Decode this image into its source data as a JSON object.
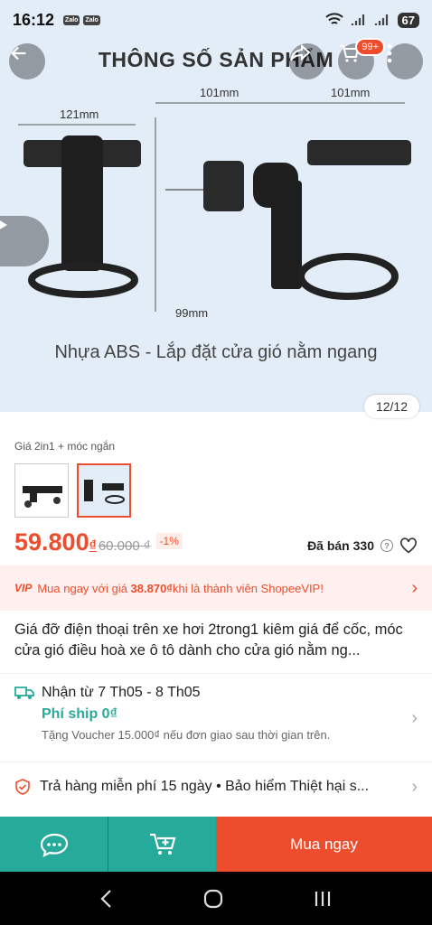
{
  "status": {
    "time": "16:12",
    "app1": "Zalo",
    "app2": "Zalo",
    "battery": "67"
  },
  "hero": {
    "title": "THÔNG SỐ SẢN PHẨM",
    "caption": "Nhựa ABS - Lắp đặt cửa gió nằm ngang",
    "dim_121": "121mm",
    "dim_101a": "101mm",
    "dim_101b": "101mm",
    "dim_99": "99mm",
    "cart_badge": "99+",
    "counter": "12/12"
  },
  "variation": {
    "label": "Giá 2in1 + móc ngắn"
  },
  "price": {
    "current": "59.800",
    "currency": "₫",
    "old": "60.000 ₫",
    "discount": "-1%",
    "sold": "Đã bán 330"
  },
  "vip": {
    "tag": "VIP",
    "text_before": "Mua ngay với giá ",
    "vip_price": "38.870₫",
    "text_after": " khi là thành viên ShopeeVIP!"
  },
  "product": {
    "title": "Giá đỡ điện thoại trên xe hơi 2trong1 kiêm giá để cốc, móc cửa gió điều hoà xe ô tô dành cho cửa gió nằm ng..."
  },
  "shipping": {
    "delivery": "Nhận từ 7 Th05 - 8 Th05",
    "fee": "Phí ship 0₫",
    "note": "Tặng Voucher 15.000₫ nếu đơn giao sau thời gian trên."
  },
  "returns": {
    "text": "Trả hàng miễn phí 15 ngày  •  Bảo hiểm Thiệt hại s..."
  },
  "footer": {
    "buy_now": "Mua ngay"
  },
  "colors": {
    "primary": "#ee4d2d",
    "teal": "#26aa99",
    "hero_bg": "#e3edf7"
  }
}
